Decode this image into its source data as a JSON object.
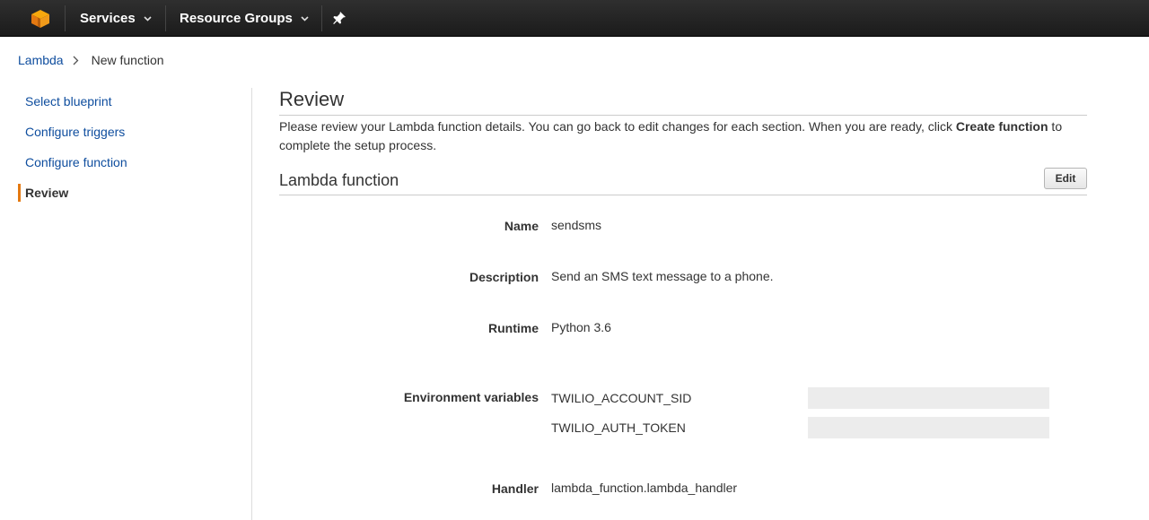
{
  "nav": {
    "logo_icon": "aws-cube-icon",
    "services_label": "Services",
    "resource_groups_label": "Resource Groups",
    "pin_icon": "pin-icon"
  },
  "breadcrumb": {
    "root": "Lambda",
    "current": "New function"
  },
  "steps": [
    {
      "label": "Select blueprint",
      "active": false
    },
    {
      "label": "Configure triggers",
      "active": false
    },
    {
      "label": "Configure function",
      "active": false
    },
    {
      "label": "Review",
      "active": true
    }
  ],
  "review": {
    "title": "Review",
    "intro_before": "Please review your Lambda function details. You can go back to edit changes for each section. When you are ready, click ",
    "intro_bold": "Create function",
    "intro_after": " to complete the setup process."
  },
  "lambda_function": {
    "section_title": "Lambda function",
    "edit_label": "Edit",
    "name_label": "Name",
    "name_value": "sendsms",
    "description_label": "Description",
    "description_value": "Send an SMS text message to a phone.",
    "runtime_label": "Runtime",
    "runtime_value": "Python 3.6",
    "env_label": "Environment variables",
    "env_vars": [
      {
        "key": "TWILIO_ACCOUNT_SID",
        "value": ""
      },
      {
        "key": "TWILIO_AUTH_TOKEN",
        "value": ""
      }
    ],
    "handler_label": "Handler",
    "handler_value": "lambda_function.lambda_handler"
  },
  "colors": {
    "accent_orange": "#e47911",
    "link_blue": "#0e4d9e",
    "nav_bg": "#232323"
  }
}
